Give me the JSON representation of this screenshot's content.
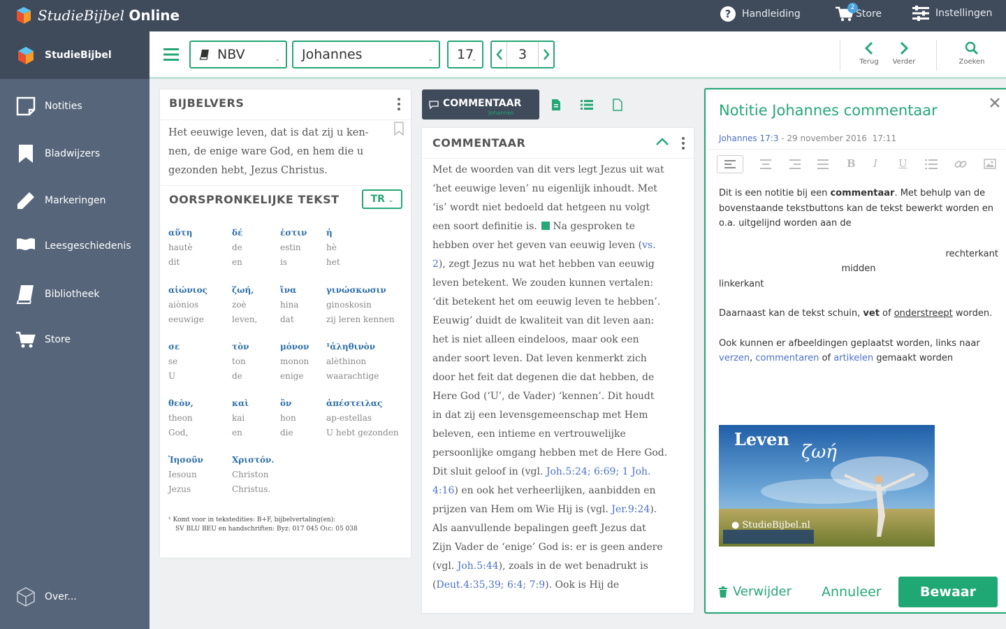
{
  "app": {
    "brand_main": "StudieBijbel",
    "brand_suffix": "Online",
    "top_nav": {
      "manual": "Handleiding",
      "store": "Store",
      "store_badge": "2",
      "settings": "Instellingen"
    }
  },
  "sidebar": {
    "items": [
      {
        "label": "StudieBijbel",
        "icon": "studiebijbel-logo-icon"
      },
      {
        "label": "Notities",
        "icon": "note-icon"
      },
      {
        "label": "Bladwijzers",
        "icon": "bookmark-icon"
      },
      {
        "label": "Markeringen",
        "icon": "pencil-icon"
      },
      {
        "label": "Leesgeschiedenis",
        "icon": "flag-icon"
      },
      {
        "label": "Bibliotheek",
        "icon": "book-icon"
      },
      {
        "label": "Store",
        "icon": "cart-icon"
      }
    ],
    "about": "Over..."
  },
  "toolbar": {
    "translation": "NBV",
    "book": "Johannes",
    "chapter": "17",
    "verse": "3",
    "back": "Terug",
    "forward": "Verder",
    "search": "Zoeken"
  },
  "verse_panel": {
    "title": "BIJBELVERS",
    "text": "Het eeuwige leven, dat is dat zij u ken-nen, de enige ware God, en hem die u gezonden hebt, Jezus Christus."
  },
  "original_panel": {
    "title": "OORSPRONKELIJKE TEKST",
    "badge": "TR",
    "words": [
      [
        "αὕτη",
        "hautè",
        "dit"
      ],
      [
        "δέ",
        "de",
        "en"
      ],
      [
        "ἐστιν",
        "estin",
        "is"
      ],
      [
        "ἡ",
        "hè",
        "het"
      ],
      [
        "αἰώνιος",
        "aiònios",
        "eeuwige"
      ],
      [
        "ζωή,",
        "zoè",
        "leven,"
      ],
      [
        "ἵνα",
        "hina",
        "dat"
      ],
      [
        "γινώσκωσιν",
        "ginoskosin",
        "zij leren kennen"
      ],
      [
        "σε",
        "se",
        "U"
      ],
      [
        "τὸν",
        "ton",
        "de"
      ],
      [
        "μόνον",
        "monon",
        "enige"
      ],
      [
        "¹ἀληθινὸν",
        "alèthinon",
        "waarachtige"
      ],
      [
        "θεὸν,",
        "theon",
        "God,"
      ],
      [
        "καὶ",
        "kai",
        "en"
      ],
      [
        "ὃν",
        "hon",
        "die"
      ],
      [
        "ἀπέστειλας",
        "ap-estellas",
        "U hebt gezonden"
      ],
      [
        "Ἰησοῦν",
        "Iesoun",
        "Jezus"
      ],
      [
        "Χριστόν.",
        "Christon",
        "Christus."
      ]
    ],
    "footnote_line1": "¹ Komt voor in tekstedities: B+F, bijbelvertaling(en):",
    "footnote_line2": "SV BLU BEU en handschriften: Byz: 017 045 Οιc: 05 038"
  },
  "commentary_panel": {
    "tab_label": "COMMENTAAR",
    "tab_sub": "Johannes",
    "title": "COMMENTAAR",
    "lines": [
      {
        "t": "Met de woorden van dit vers legt Jezus uit wat"
      },
      {
        "t": "‘het eeuwige leven’ nu eigenlijk inhoudt. Met"
      },
      {
        "t": "‘is’ wordt niet bedoeld dat hetgeen nu volgt"
      },
      {
        "t": "een soort definitie is.",
        "t2": " Na gesproken te",
        "marker": true
      },
      {
        "t": "hebben over het geven van eeuwig leven (",
        "link": "vs.",
        "after": ""
      },
      {
        "t": "",
        "link": "2",
        "after": "), zegt Jezus nu wat het hebben van eeuwig"
      },
      {
        "t": "leven betekent. We zouden kunnen vertalen:"
      },
      {
        "t": "‘dit betekent het om eeuwig leven te hebben’."
      },
      {
        "t": "Eeuwig’ duidt de kwaliteit van dit leven aan:"
      },
      {
        "t": "het is niet alleen eindeloos, maar ook een"
      },
      {
        "t": "ander soort leven. Dat leven kenmerkt zich"
      },
      {
        "t": "door het feit dat degenen die dat hebben, de"
      },
      {
        "t": "Here God (‘U’, de Vader) ‘kennen’. Dit houdt"
      },
      {
        "t": "in dat zij een levensgemeenschap met Hem"
      },
      {
        "t": "beleven, een intieme en vertrouwelijke"
      },
      {
        "t": "persoonlijke omgang hebben met de Here God."
      },
      {
        "t": "Dit sluit geloof in (vgl. ",
        "link": "Joh.5:24; 6:69; 1 Joh.",
        "after": ""
      },
      {
        "t": "",
        "link": "4:16",
        "after": ") en ook het verheerlijken, aanbidden en"
      },
      {
        "t": "prijzen van Hem om Wie Hij is (vgl. ",
        "link": "Jer.9:24",
        "after": ")."
      },
      {
        "t": "Als aanvullende bepalingen geeft Jezus dat"
      },
      {
        "t": "Zijn Vader de ‘enige’ God is: er is geen andere"
      },
      {
        "t": "(vgl. ",
        "link": "Joh.5:44",
        "after": "), zoals in de wet benadrukt is"
      },
      {
        "t": "(",
        "link": "Deut.4:35,39; 6:4; 7:9",
        "after": "). Ook is Hij de"
      }
    ]
  },
  "note_panel": {
    "title": "Notitie Johannes commentaar",
    "ref": "Johannes 17:3",
    "date": "29 november 2016",
    "time": "17:11",
    "para1_a": "Dit is een notitie bij een ",
    "para1_b": "commentaar",
    "para1_c": ". Met behulp van de bovenstaande tekstbuttons kan de tekst bewerkt worden en o.a. uitgelijnd worden aan de",
    "align_right": "rechterkant",
    "align_center": "midden",
    "align_left": "linkerkant",
    "para2_a": "Daarnaast kan de tekst schuin, ",
    "para2_b": "vet",
    "para2_c": " of ",
    "para2_d": "onderstreept",
    "para2_e": " worden.",
    "para3_a": "Ook kunnen er afbeeldingen geplaatst worden, links naar ",
    "link_verses": "verzen",
    "sep": ", ",
    "link_comments": "commentaren",
    "para3_of": " of ",
    "link_articles": "artikelen",
    "para3_end": " gemaakt worden",
    "image": {
      "title": "Leven",
      "greek": "ζωή",
      "caption": "StudieBijbel.nl"
    },
    "delete": "Verwijder",
    "cancel": "Annuleer",
    "save": "Bewaar"
  },
  "colors": {
    "topbar": "#3f4a5b",
    "sidebar": "#56657a",
    "accent": "#25a776",
    "link": "#4d71c4",
    "greek": "#2e6ea8"
  }
}
